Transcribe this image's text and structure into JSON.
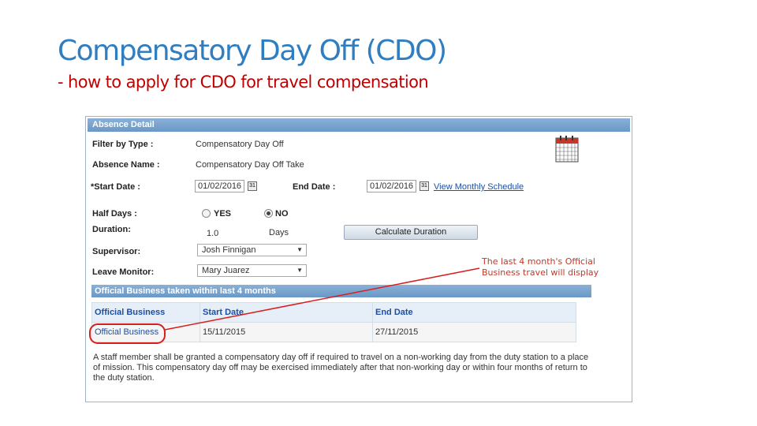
{
  "slide": {
    "title": "Compensatory Day Off (CDO)",
    "subtitle": "- how to apply for CDO for travel compensation",
    "annotation": "The last 4 month's Official\nBusiness travel will display"
  },
  "absence_detail": {
    "header": "Absence Detail",
    "filter_label": "Filter by Type :",
    "filter_value": "Compensatory Day Off",
    "name_label": "Absence Name :",
    "name_value": "Compensatory Day Off Take",
    "start_label": "*Start Date :",
    "start_value": "01/02/2016",
    "end_label": "End Date :",
    "end_value": "01/02/2016",
    "calendar_glyph": "31",
    "schedule_link": "View Monthly Schedule",
    "half_days_label": "Half Days :",
    "yes_label": "YES",
    "no_label": "NO",
    "half_days_selected": "NO",
    "duration_label": "Duration:",
    "duration_value": "1.0",
    "duration_unit": "Days",
    "calc_button": "Calculate Duration",
    "supervisor_label": "Supervisor:",
    "supervisor_value": "Josh Finnigan",
    "monitor_label": "Leave Monitor:",
    "monitor_value": "Mary Juarez"
  },
  "official_business": {
    "header": "Official Business taken within last 4 months",
    "columns": [
      "Official Business",
      "Start Date",
      "End Date"
    ],
    "rows": [
      {
        "type": "Official Business",
        "start": "15/11/2015",
        "end": "27/11/2015"
      }
    ],
    "note": "A staff member shall be granted a compensatory day off if required to travel on a non-working day from the duty station to a place of mission. This compensatory day off may be exercised immediately after that non-working day or within four months of return to the duty station."
  },
  "colors": {
    "title": "#2e7ec1",
    "accent_red": "#c00000",
    "header_blue": "#6a98c7"
  }
}
